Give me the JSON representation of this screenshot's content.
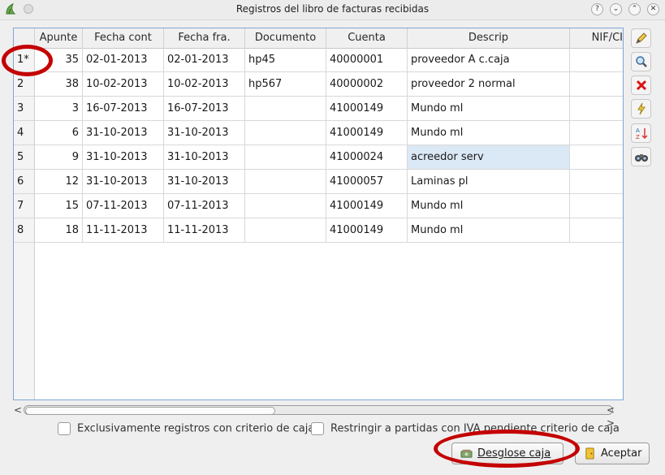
{
  "window": {
    "title": "Registros del libro de facturas recibidas",
    "controls": [
      "?",
      "⌄",
      "⌃",
      "✕"
    ]
  },
  "table": {
    "columns": [
      "Apunte",
      "Fecha cont",
      "Fecha fra.",
      "Documento",
      "Cuenta",
      "Descrip",
      "NIF/CI"
    ],
    "rows": [
      {
        "num": "1*",
        "apunte": "35",
        "fecha_cont": "02-01-2013",
        "fecha_fra": "02-01-2013",
        "documento": "hp45",
        "cuenta": "40000001",
        "descrip": "proveedor A c.caja",
        "nif": ""
      },
      {
        "num": "2",
        "apunte": "38",
        "fecha_cont": "10-02-2013",
        "fecha_fra": "10-02-2013",
        "documento": "hp567",
        "cuenta": "40000002",
        "descrip": "proveedor 2 normal",
        "nif": ""
      },
      {
        "num": "3",
        "apunte": "3",
        "fecha_cont": "16-07-2013",
        "fecha_fra": "16-07-2013",
        "documento": "",
        "cuenta": "41000149",
        "descrip": "Mundo ml",
        "nif": ""
      },
      {
        "num": "4",
        "apunte": "6",
        "fecha_cont": "31-10-2013",
        "fecha_fra": "31-10-2013",
        "documento": "",
        "cuenta": "41000149",
        "descrip": "Mundo ml",
        "nif": ""
      },
      {
        "num": "5",
        "apunte": "9",
        "fecha_cont": "31-10-2013",
        "fecha_fra": "31-10-2013",
        "documento": "",
        "cuenta": "41000024",
        "descrip": "acreedor serv",
        "nif": ""
      },
      {
        "num": "6",
        "apunte": "12",
        "fecha_cont": "31-10-2013",
        "fecha_fra": "31-10-2013",
        "documento": "",
        "cuenta": "41000057",
        "descrip": "Laminas pl",
        "nif": ""
      },
      {
        "num": "7",
        "apunte": "15",
        "fecha_cont": "07-11-2013",
        "fecha_fra": "07-11-2013",
        "documento": "",
        "cuenta": "41000149",
        "descrip": "Mundo ml",
        "nif": ""
      },
      {
        "num": "8",
        "apunte": "18",
        "fecha_cont": "11-11-2013",
        "fecha_fra": "11-11-2013",
        "documento": "",
        "cuenta": "41000149",
        "descrip": "Mundo ml",
        "nif": ""
      }
    ]
  },
  "checkboxes": {
    "criterio_caja": "Exclusivamente registros con criterio de caja",
    "iva_pendiente": "Restringir a partidas con IVA pendiente criterio de caja"
  },
  "buttons": {
    "desglose": "Desglose caja",
    "aceptar": "Aceptar"
  },
  "scroll": {
    "left": "<",
    "right_pair": "< >"
  },
  "colors": {
    "selection": "#dbe8f6",
    "annotation": "#c40000",
    "table_border": "#7fa7d3"
  }
}
